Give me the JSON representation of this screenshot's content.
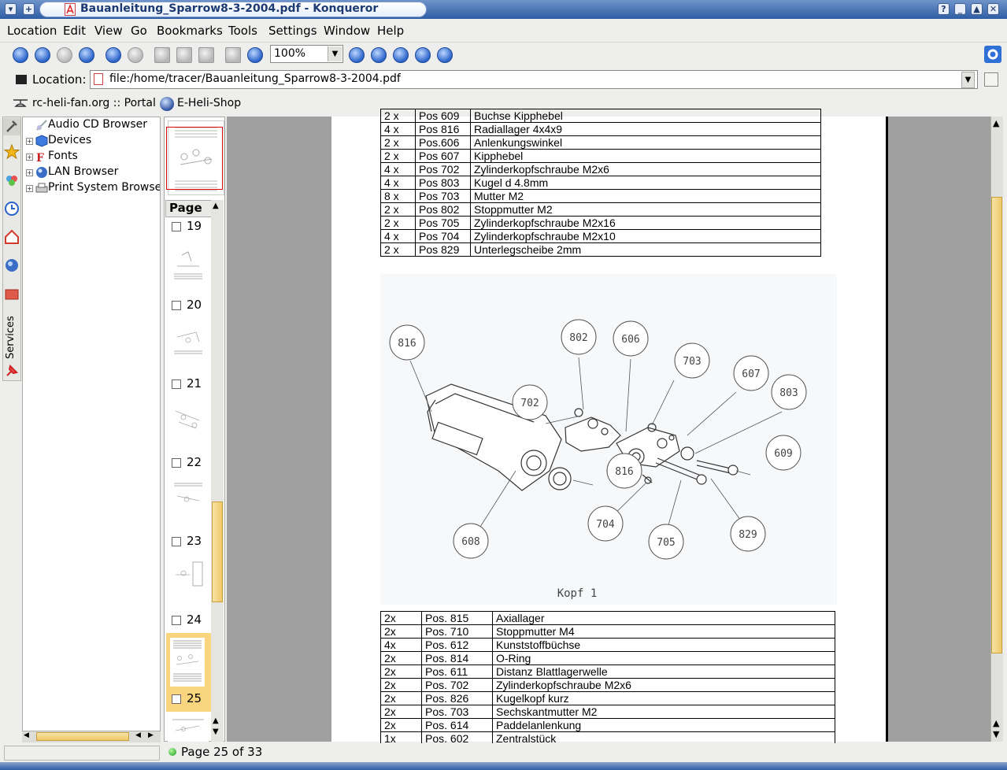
{
  "window": {
    "title": "Bauanleitung_Sparrow8-3-2004.pdf - Konqueror"
  },
  "menu": [
    "Location",
    "Edit",
    "View",
    "Go",
    "Bookmarks",
    "Tools",
    "Settings",
    "Window",
    "Help"
  ],
  "toolbar": {
    "zoom": "100%"
  },
  "location": {
    "label": "Location:",
    "url": "file:/home/tracer/Bauanleitung_Sparrow8-3-2004.pdf"
  },
  "bookmarks": [
    "rc-heli-fan.org :: Portal",
    "E-Heli-Shop"
  ],
  "sidebar_tabs": {
    "services": "Services"
  },
  "tree": [
    "Audio CD Browser",
    "Devices",
    "Fonts",
    "LAN Browser",
    "Print System Browse"
  ],
  "thumbnails": {
    "header": "Page",
    "pages": [
      "19",
      "20",
      "21",
      "22",
      "23",
      "24",
      "25"
    ],
    "selected": "25"
  },
  "document": {
    "table_top": [
      [
        "2 x",
        "Pos 609",
        "Buchse Kipphebel"
      ],
      [
        "4 x",
        "Pos 816",
        "Radiallager 4x4x9"
      ],
      [
        "2 x",
        "Pos.606",
        "Anlenkungswinkel"
      ],
      [
        "2 x",
        "Pos 607",
        "Kipphebel"
      ],
      [
        "4 x",
        "Pos 702",
        "Zylinderkopfschraube M2x6"
      ],
      [
        "4 x",
        "Pos 803",
        "Kugel d 4.8mm"
      ],
      [
        "8 x",
        "Pos 703",
        "Mutter M2"
      ],
      [
        "2 x",
        "Pos 802",
        "Stoppmutter M2"
      ],
      [
        "2 x",
        "Pos 705",
        "Zylinderkopfschraube M2x16"
      ],
      [
        "4 x",
        "Pos 704",
        "Zylinderkopfschraube M2x10"
      ],
      [
        "2 x",
        "Pos 829",
        "Unterlegscheibe 2mm"
      ]
    ],
    "figure_labels": [
      "816",
      "802",
      "606",
      "703",
      "607",
      "803",
      "702",
      "609",
      "816",
      "704",
      "705",
      "829",
      "608"
    ],
    "figure_caption": "Kopf 1",
    "table_bottom": [
      [
        "2x",
        "Pos. 815",
        "Axiallager"
      ],
      [
        "2x",
        "Pos. 710",
        "Stoppmutter M4"
      ],
      [
        "4x",
        "Pos. 612",
        "Kunststoffbüchse"
      ],
      [
        "2x",
        "Pos. 814",
        "O-Ring"
      ],
      [
        "2x",
        "Pos. 611",
        "Distanz Blattlagerwelle"
      ],
      [
        "2x",
        "Pos. 702",
        "Zylinderkopfschraube M2x6"
      ],
      [
        "2x",
        "Pos. 826",
        "Kugelkopf kurz"
      ],
      [
        "2x",
        "Pos. 703",
        "Sechskantmutter M2"
      ],
      [
        "2x",
        "Pos. 614",
        "Paddelanlenkung"
      ],
      [
        "1x",
        "Pos. 602",
        "Zentralstück"
      ]
    ]
  },
  "status": {
    "text": "Page 25 of 33"
  },
  "colors": {
    "titlebar": "#2f5da4",
    "selection": "#f8d57e",
    "scroll_thumb": "#f0c968"
  }
}
